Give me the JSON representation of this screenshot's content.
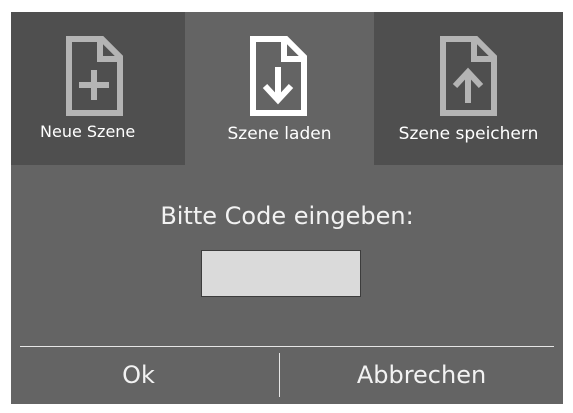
{
  "tabs": {
    "new_scene": {
      "label": "Neue Szene",
      "icon": "file-plus-icon"
    },
    "load_scene": {
      "label": "Szene laden",
      "icon": "file-download-icon",
      "active": true
    },
    "save_scene": {
      "label": "Szene speichern",
      "icon": "file-upload-icon"
    }
  },
  "prompt": {
    "text": "Bitte Code eingeben:"
  },
  "code_input": {
    "value": "",
    "placeholder": ""
  },
  "buttons": {
    "ok": "Ok",
    "cancel": "Abbrechen"
  },
  "colors": {
    "dialog_bg": "#646464",
    "inactive_tab_bg": "#4f4f4f",
    "active_icon": "#ffffff",
    "inactive_icon": "#b4b4b4",
    "input_bg": "#dadada"
  }
}
